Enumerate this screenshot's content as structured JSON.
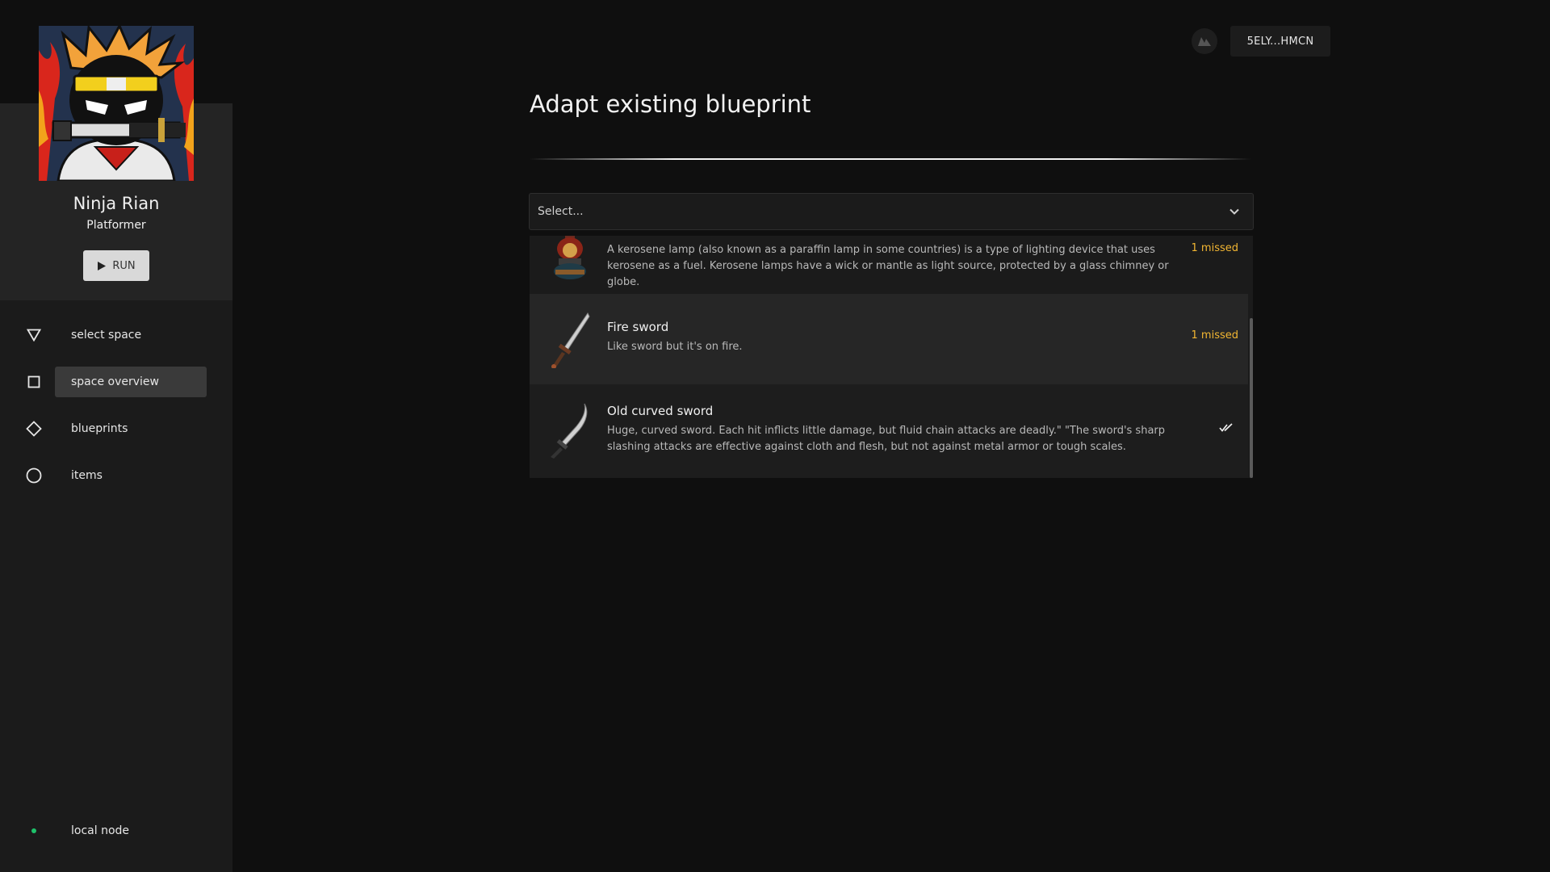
{
  "space": {
    "name": "Ninja Rian",
    "genre": "Platformer",
    "run_label": "RUN"
  },
  "nav": {
    "items": [
      {
        "label": "select space",
        "icon": "triangle-down-icon"
      },
      {
        "label": "space overview",
        "icon": "square-icon"
      },
      {
        "label": "blueprints",
        "icon": "diamond-icon"
      },
      {
        "label": "items",
        "icon": "circle-icon"
      }
    ],
    "active_item": "space overview"
  },
  "node": {
    "label": "local node",
    "status_color": "#1ec26a"
  },
  "topbar": {
    "wallet_label": "5ELY...HMCN",
    "wallet_icon": "wallet-avatar-icon"
  },
  "page": {
    "title": "Adapt existing blueprint"
  },
  "select": {
    "placeholder": "Select..."
  },
  "blueprints": [
    {
      "name": "",
      "description": "A kerosene lamp (also known as a paraffin lamp in some countries) is a type of lighting device that uses kerosene as a fuel. Kerosene lamps have a wick or mantle as light source, protected by a glass chimney or globe.",
      "status": "1 missed",
      "image": "kerosene-lamp-icon"
    },
    {
      "name": "Fire sword",
      "description": "Like sword but it's on fire.",
      "status": "1 missed",
      "image": "fire-sword-icon"
    },
    {
      "name": "Old curved sword",
      "description": "Huge, curved sword. Each hit inflicts little damage, but fluid chain attacks are deadly.\" \"The sword's sharp slashing attacks are effective against cloth and flesh, but not against metal armor or tough scales.",
      "status": "",
      "status_icon": "double-check-icon",
      "image": "curved-sword-icon"
    }
  ],
  "colors": {
    "missed": "#f2b632",
    "accent_dot": "#1ec26a"
  }
}
